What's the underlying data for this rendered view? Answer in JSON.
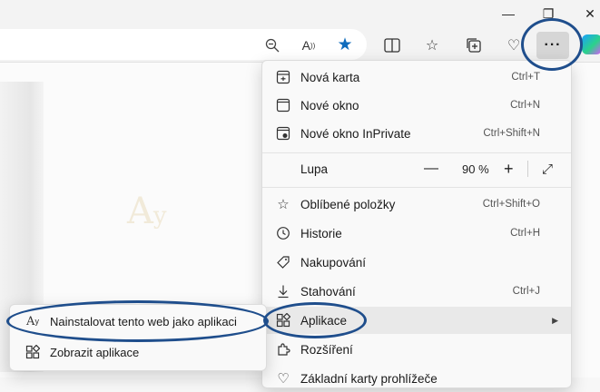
{
  "window": {
    "minimize_icon": "minimize-icon",
    "restore_icon": "restore-icon",
    "close_icon": "close-icon"
  },
  "toolbar": {
    "icons": [
      "zoom-out-icon",
      "read-aloud-icon",
      "favorite-star-icon",
      "split-screen-icon",
      "favorites-icon",
      "collections-icon",
      "browser-essentials-icon",
      "more-options-icon",
      "copilot-icon"
    ],
    "more_label": "···"
  },
  "menu": {
    "items": [
      {
        "label": "Nová karta",
        "shortcut": "Ctrl+T",
        "icon": "new-tab-icon"
      },
      {
        "label": "Nové okno",
        "shortcut": "Ctrl+N",
        "icon": "new-window-icon"
      },
      {
        "label": "Nové okno InPrivate",
        "shortcut": "Ctrl+Shift+N",
        "icon": "inprivate-icon"
      },
      {
        "label": "Lupa",
        "icon": "none"
      },
      {
        "label": "Oblíbené položky",
        "shortcut": "Ctrl+Shift+O",
        "icon": "favorites-icon"
      },
      {
        "label": "Historie",
        "shortcut": "Ctrl+H",
        "icon": "history-icon"
      },
      {
        "label": "Nakupování",
        "icon": "shopping-tag-icon"
      },
      {
        "label": "Stahování",
        "shortcut": "Ctrl+J",
        "icon": "download-icon"
      },
      {
        "label": "Aplikace",
        "icon": "apps-icon"
      },
      {
        "label": "Rozšíření",
        "icon": "extensions-icon"
      },
      {
        "label": "Základní karty prohlížeče",
        "icon": "browser-essentials-icon"
      }
    ],
    "zoom": {
      "minus": "—",
      "value": "90 %",
      "plus": "+",
      "fullscreen_icon": "fullscreen-icon"
    }
  },
  "submenu": {
    "items": [
      {
        "label": "Nainstalovat tento web jako aplikaci",
        "icon": "install-app-icon"
      },
      {
        "label": "Zobrazit aplikace",
        "icon": "apps-icon"
      }
    ]
  },
  "colors": {
    "annotation": "#1f4e8c",
    "accent": "#0f6cbd"
  }
}
